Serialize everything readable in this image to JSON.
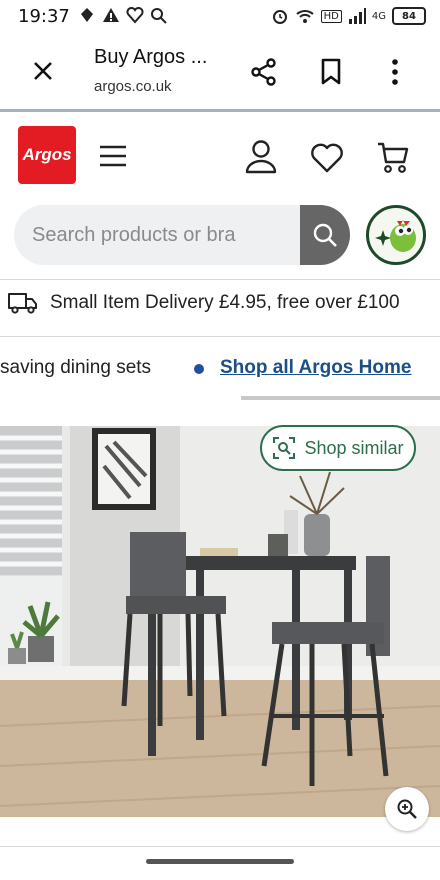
{
  "status_bar": {
    "time": "19:37",
    "network": "4G",
    "battery": "84",
    "hd": "HD"
  },
  "custom_tab": {
    "title": "Buy Argos ...",
    "url": "argos.co.uk",
    "icons": [
      "close-icon",
      "share-icon",
      "bookmark-icon",
      "more-vert-icon"
    ]
  },
  "header": {
    "logo_text": "Argos",
    "brand_color": "#e21c22",
    "icons": [
      "menu-icon",
      "account-icon",
      "wishlist-heart-icon",
      "trolley-icon"
    ]
  },
  "search": {
    "placeholder": "Search products or bra"
  },
  "delivery_banner": {
    "text": "Small Item Delivery £4.95, free over £100"
  },
  "promo_strip": {
    "text": "saving dining sets",
    "link": "Shop all Argos Home",
    "link_color": "#1a4f8b"
  },
  "product_image": {
    "shop_similar_label": "Shop similar",
    "accent_color": "#2d6e4e"
  }
}
